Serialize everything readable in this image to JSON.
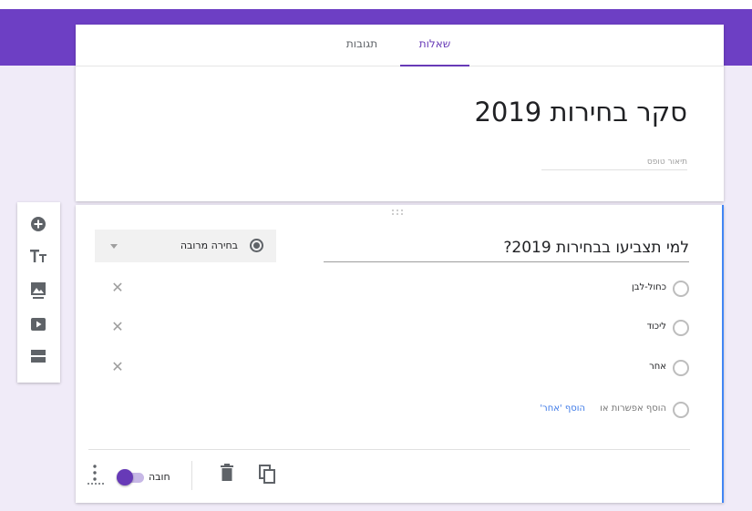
{
  "tabs": {
    "questions": "שאלות",
    "responses": "תגובות"
  },
  "form": {
    "title": "סקר בחירות 2019",
    "description_placeholder": "תיאור טופס"
  },
  "question": {
    "title": "למי תצביעו בבחירות 2019?",
    "type_label": "בחירה מרובה",
    "options": [
      {
        "label": "כחול-לבן"
      },
      {
        "label": "ליכוד"
      },
      {
        "label": "אחר"
      }
    ],
    "add_option": "הוסף אפשרות או",
    "add_other": "הוסף 'אחר'",
    "required_label": "חובה",
    "required": true
  },
  "colors": {
    "brand": "#6d3fc4",
    "accent": "#673ab7",
    "link": "#3b78e7"
  },
  "icons": {
    "toolbar": [
      "add-question-icon",
      "add-title-icon",
      "add-image-icon",
      "add-video-icon",
      "add-section-icon"
    ],
    "footer": [
      "duplicate-icon",
      "delete-icon",
      "more-options-icon"
    ]
  }
}
